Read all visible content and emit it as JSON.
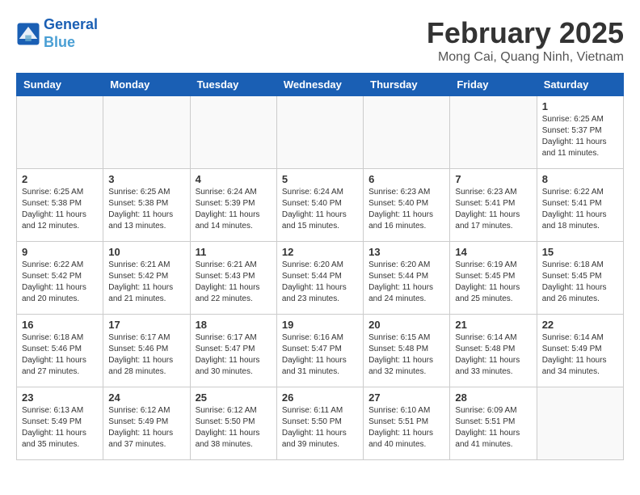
{
  "header": {
    "logo_line1": "General",
    "logo_line2": "Blue",
    "title": "February 2025",
    "subtitle": "Mong Cai, Quang Ninh, Vietnam"
  },
  "weekdays": [
    "Sunday",
    "Monday",
    "Tuesday",
    "Wednesday",
    "Thursday",
    "Friday",
    "Saturday"
  ],
  "weeks": [
    [
      {
        "day": "",
        "info": ""
      },
      {
        "day": "",
        "info": ""
      },
      {
        "day": "",
        "info": ""
      },
      {
        "day": "",
        "info": ""
      },
      {
        "day": "",
        "info": ""
      },
      {
        "day": "",
        "info": ""
      },
      {
        "day": "1",
        "info": "Sunrise: 6:25 AM\nSunset: 5:37 PM\nDaylight: 11 hours\nand 11 minutes."
      }
    ],
    [
      {
        "day": "2",
        "info": "Sunrise: 6:25 AM\nSunset: 5:38 PM\nDaylight: 11 hours\nand 12 minutes."
      },
      {
        "day": "3",
        "info": "Sunrise: 6:25 AM\nSunset: 5:38 PM\nDaylight: 11 hours\nand 13 minutes."
      },
      {
        "day": "4",
        "info": "Sunrise: 6:24 AM\nSunset: 5:39 PM\nDaylight: 11 hours\nand 14 minutes."
      },
      {
        "day": "5",
        "info": "Sunrise: 6:24 AM\nSunset: 5:40 PM\nDaylight: 11 hours\nand 15 minutes."
      },
      {
        "day": "6",
        "info": "Sunrise: 6:23 AM\nSunset: 5:40 PM\nDaylight: 11 hours\nand 16 minutes."
      },
      {
        "day": "7",
        "info": "Sunrise: 6:23 AM\nSunset: 5:41 PM\nDaylight: 11 hours\nand 17 minutes."
      },
      {
        "day": "8",
        "info": "Sunrise: 6:22 AM\nSunset: 5:41 PM\nDaylight: 11 hours\nand 18 minutes."
      }
    ],
    [
      {
        "day": "9",
        "info": "Sunrise: 6:22 AM\nSunset: 5:42 PM\nDaylight: 11 hours\nand 20 minutes."
      },
      {
        "day": "10",
        "info": "Sunrise: 6:21 AM\nSunset: 5:42 PM\nDaylight: 11 hours\nand 21 minutes."
      },
      {
        "day": "11",
        "info": "Sunrise: 6:21 AM\nSunset: 5:43 PM\nDaylight: 11 hours\nand 22 minutes."
      },
      {
        "day": "12",
        "info": "Sunrise: 6:20 AM\nSunset: 5:44 PM\nDaylight: 11 hours\nand 23 minutes."
      },
      {
        "day": "13",
        "info": "Sunrise: 6:20 AM\nSunset: 5:44 PM\nDaylight: 11 hours\nand 24 minutes."
      },
      {
        "day": "14",
        "info": "Sunrise: 6:19 AM\nSunset: 5:45 PM\nDaylight: 11 hours\nand 25 minutes."
      },
      {
        "day": "15",
        "info": "Sunrise: 6:18 AM\nSunset: 5:45 PM\nDaylight: 11 hours\nand 26 minutes."
      }
    ],
    [
      {
        "day": "16",
        "info": "Sunrise: 6:18 AM\nSunset: 5:46 PM\nDaylight: 11 hours\nand 27 minutes."
      },
      {
        "day": "17",
        "info": "Sunrise: 6:17 AM\nSunset: 5:46 PM\nDaylight: 11 hours\nand 28 minutes."
      },
      {
        "day": "18",
        "info": "Sunrise: 6:17 AM\nSunset: 5:47 PM\nDaylight: 11 hours\nand 30 minutes."
      },
      {
        "day": "19",
        "info": "Sunrise: 6:16 AM\nSunset: 5:47 PM\nDaylight: 11 hours\nand 31 minutes."
      },
      {
        "day": "20",
        "info": "Sunrise: 6:15 AM\nSunset: 5:48 PM\nDaylight: 11 hours\nand 32 minutes."
      },
      {
        "day": "21",
        "info": "Sunrise: 6:14 AM\nSunset: 5:48 PM\nDaylight: 11 hours\nand 33 minutes."
      },
      {
        "day": "22",
        "info": "Sunrise: 6:14 AM\nSunset: 5:49 PM\nDaylight: 11 hours\nand 34 minutes."
      }
    ],
    [
      {
        "day": "23",
        "info": "Sunrise: 6:13 AM\nSunset: 5:49 PM\nDaylight: 11 hours\nand 35 minutes."
      },
      {
        "day": "24",
        "info": "Sunrise: 6:12 AM\nSunset: 5:49 PM\nDaylight: 11 hours\nand 37 minutes."
      },
      {
        "day": "25",
        "info": "Sunrise: 6:12 AM\nSunset: 5:50 PM\nDaylight: 11 hours\nand 38 minutes."
      },
      {
        "day": "26",
        "info": "Sunrise: 6:11 AM\nSunset: 5:50 PM\nDaylight: 11 hours\nand 39 minutes."
      },
      {
        "day": "27",
        "info": "Sunrise: 6:10 AM\nSunset: 5:51 PM\nDaylight: 11 hours\nand 40 minutes."
      },
      {
        "day": "28",
        "info": "Sunrise: 6:09 AM\nSunset: 5:51 PM\nDaylight: 11 hours\nand 41 minutes."
      },
      {
        "day": "",
        "info": ""
      }
    ]
  ]
}
